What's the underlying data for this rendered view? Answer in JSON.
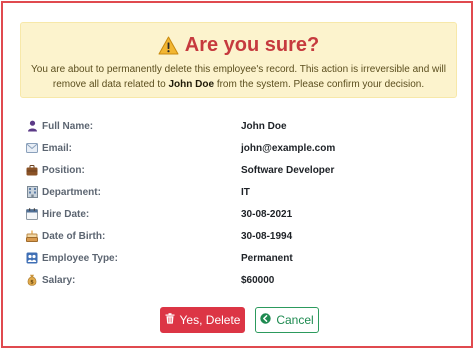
{
  "alert": {
    "title": "Are you sure?",
    "message_before": "You are about to permanently delete this employee's record. This action is irreversible and will remove all data related to ",
    "employee_name": "John Doe",
    "message_after": " from the system. Please confirm your decision.",
    "icon": "warning-icon",
    "colors": {
      "background": "#fcf3cd",
      "title": "#c63a3e"
    }
  },
  "details": [
    {
      "icon": "person-icon",
      "label": "Full Name:",
      "value": "John Doe"
    },
    {
      "icon": "email-icon",
      "label": "Email:",
      "value": "john@example.com"
    },
    {
      "icon": "briefcase-icon",
      "label": "Position:",
      "value": "Software Developer"
    },
    {
      "icon": "building-icon",
      "label": "Department:",
      "value": "IT"
    },
    {
      "icon": "calendar-icon",
      "label": "Hire Date:",
      "value": "30-08-2021"
    },
    {
      "icon": "cake-icon",
      "label": "Date of Birth:",
      "value": "30-08-1994"
    },
    {
      "icon": "people-icon",
      "label": "Employee Type:",
      "value": "Permanent"
    },
    {
      "icon": "money-bag-icon",
      "label": "Salary:",
      "value": "$60000"
    }
  ],
  "actions": {
    "delete_label": "Yes, Delete",
    "cancel_label": "Cancel",
    "colors": {
      "danger": "#dc3545",
      "success": "#2c9a5d"
    }
  }
}
